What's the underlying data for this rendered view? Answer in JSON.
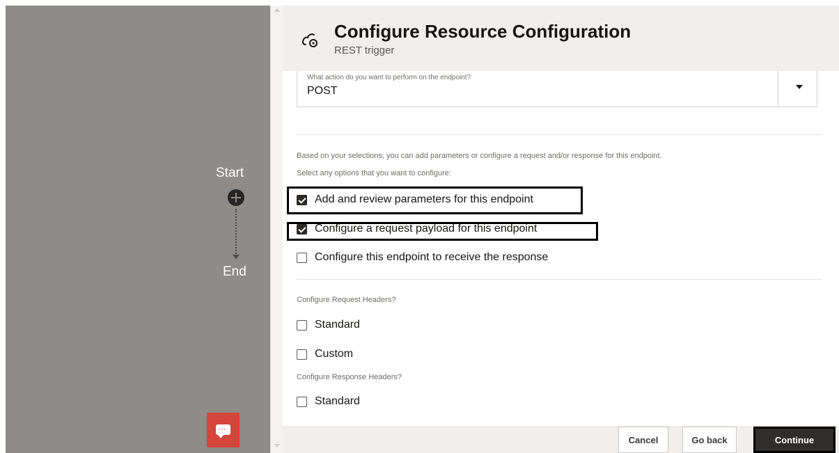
{
  "canvas": {
    "start_label": "Start",
    "end_label": "End"
  },
  "dialog": {
    "title": "Configure Resource Configuration",
    "subtitle": "REST trigger",
    "action_select": {
      "label": "What action do you want to perform on the endpoint?",
      "value": "POST"
    },
    "info_line_1": "Based on your selections, you can add parameters or configure a request and/or response for this endpoint.",
    "info_line_2": "Select any options that you want to configure:",
    "options": [
      {
        "label": "Add and review parameters for this endpoint",
        "checked": true
      },
      {
        "label": "Configure a request payload for this endpoint",
        "checked": true
      },
      {
        "label": "Configure this endpoint to receive the response",
        "checked": false
      }
    ],
    "request_headers_label": "Configure Request Headers?",
    "request_headers": [
      {
        "label": "Standard",
        "checked": false
      },
      {
        "label": "Custom",
        "checked": false
      }
    ],
    "response_headers_label": "Configure Response Headers?",
    "response_headers": [
      {
        "label": "Standard",
        "checked": false
      }
    ]
  },
  "footer": {
    "cancel_label": "Cancel",
    "go_back_label": "Go back",
    "continue_label": "Continue"
  },
  "colors": {
    "canvas_bg": "#8e8b89",
    "header_bg": "#f1efed",
    "chat_button": "#d6453a",
    "primary_button": "#312d2a",
    "highlight_border": "#000000"
  }
}
